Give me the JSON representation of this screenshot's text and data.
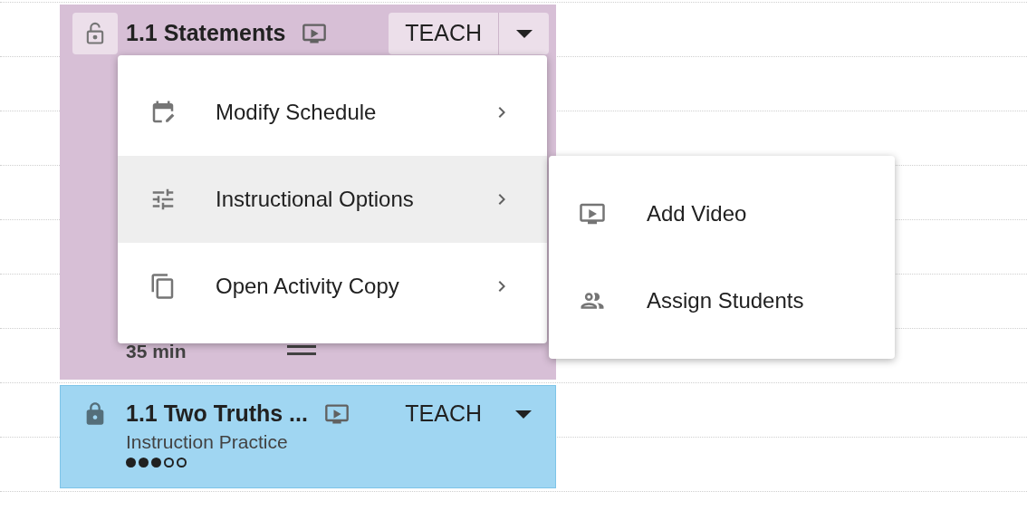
{
  "cards": [
    {
      "title": "1.1 Statements",
      "locked": false,
      "open": true,
      "action": "TEACH",
      "duration": "35 min",
      "color": "#d7bfd6"
    },
    {
      "title": "1.1 Two Truths ...",
      "locked": true,
      "open": false,
      "action": "TEACH",
      "subtitle": "Instruction Practice",
      "stars": 3,
      "color": "#a0d6f2"
    }
  ],
  "menu": {
    "items": [
      {
        "label": "Modify Schedule",
        "kind": "calendar",
        "selected": false
      },
      {
        "label": "Instructional Options",
        "kind": "sliders",
        "selected": true
      },
      {
        "label": "Open Activity Copy",
        "kind": "copy",
        "selected": false
      }
    ]
  },
  "submenu": {
    "items": [
      {
        "label": "Add Video",
        "kind": "video"
      },
      {
        "label": "Assign Students",
        "kind": "people"
      }
    ]
  }
}
